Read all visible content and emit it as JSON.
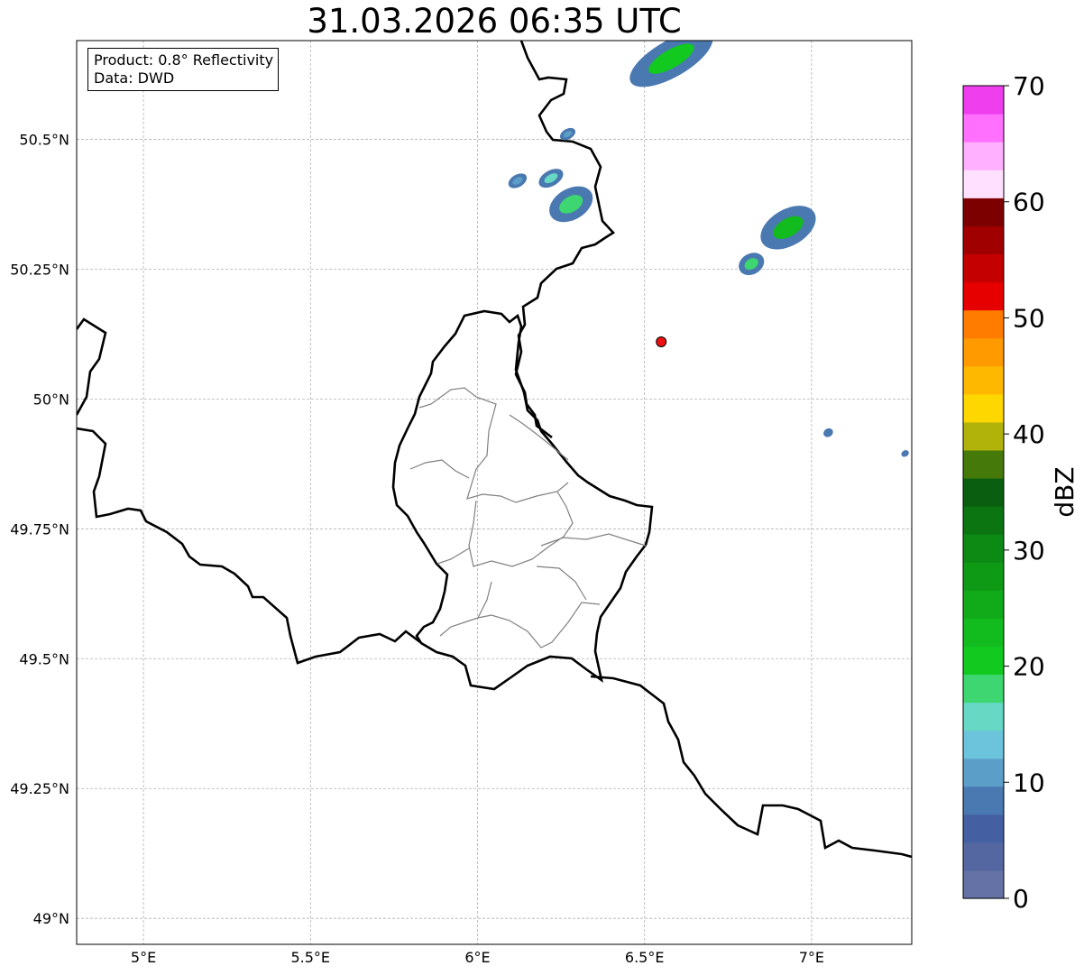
{
  "title": "31.03.2026 06:35 UTC",
  "info": {
    "product": "Product: 0.8° Reflectivity",
    "data_source": "Data: DWD"
  },
  "map": {
    "lon_range": [
      4.8,
      7.3
    ],
    "lat_range": [
      48.95,
      50.69
    ],
    "x_ticks": [
      {
        "value": 5.0,
        "label": "5°E"
      },
      {
        "value": 5.5,
        "label": "5.5°E"
      },
      {
        "value": 6.0,
        "label": "6°E"
      },
      {
        "value": 6.5,
        "label": "6.5°E"
      },
      {
        "value": 7.0,
        "label": "7°E"
      }
    ],
    "y_ticks": [
      {
        "value": 49.0,
        "label": "49°N"
      },
      {
        "value": 49.25,
        "label": "49.25°N"
      },
      {
        "value": 49.5,
        "label": "49.5°N"
      },
      {
        "value": 49.75,
        "label": "49.75°N"
      },
      {
        "value": 50.0,
        "label": "50°N"
      },
      {
        "value": 50.25,
        "label": "50.25°N"
      },
      {
        "value": 50.5,
        "label": "50.5°N"
      }
    ],
    "grid": true,
    "radar_site": {
      "lon": 6.55,
      "lat": 50.11,
      "color": "#ee1111"
    }
  },
  "colorbar": {
    "label": "dBZ",
    "range": [
      0,
      70
    ],
    "ticks": [
      {
        "value": 0,
        "label": "0"
      },
      {
        "value": 10,
        "label": "10"
      },
      {
        "value": 20,
        "label": "20"
      },
      {
        "value": 30,
        "label": "30"
      },
      {
        "value": 40,
        "label": "40"
      },
      {
        "value": 50,
        "label": "50"
      },
      {
        "value": 60,
        "label": "60"
      },
      {
        "value": 70,
        "label": "70"
      }
    ],
    "colors": [
      "#6472a6",
      "#5567a0",
      "#4460a3",
      "#4a78b0",
      "#5b9fc8",
      "#6bc4dc",
      "#66d8c4",
      "#3dd670",
      "#12c91f",
      "#12bb1e",
      "#11aa18",
      "#0f9a16",
      "#0d8a14",
      "#0b7512",
      "#0a5e0f",
      "#457a0a",
      "#b2b30a",
      "#ffd700",
      "#ffb800",
      "#ff9a00",
      "#ff7c00",
      "#e60000",
      "#c40000",
      "#a00000",
      "#7c0000",
      "#ffe0ff",
      "#ffb0ff",
      "#ff70ff",
      "#ee3eee"
    ]
  },
  "echoes": [
    {
      "lon": 6.58,
      "lat": 50.655,
      "rx": 0.14,
      "ry": 0.035,
      "color": "#4a78b0",
      "core": "#12c91f"
    },
    {
      "lon": 6.28,
      "lat": 50.375,
      "rx": 0.07,
      "ry": 0.03,
      "color": "#4a78b0",
      "core": "#3dd670"
    },
    {
      "lon": 6.22,
      "lat": 50.425,
      "rx": 0.04,
      "ry": 0.015,
      "color": "#4a78b0",
      "core": "#66d8c4"
    },
    {
      "lon": 6.12,
      "lat": 50.42,
      "rx": 0.03,
      "ry": 0.012,
      "color": "#4a78b0",
      "core": "#5b9fc8"
    },
    {
      "lon": 6.27,
      "lat": 50.51,
      "rx": 0.025,
      "ry": 0.01,
      "color": "#4a78b0",
      "core": "#5b9fc8"
    },
    {
      "lon": 6.93,
      "lat": 50.33,
      "rx": 0.09,
      "ry": 0.035,
      "color": "#4a78b0",
      "core": "#12bb1e"
    },
    {
      "lon": 6.82,
      "lat": 50.26,
      "rx": 0.04,
      "ry": 0.02,
      "color": "#4a78b0",
      "core": "#3dd670"
    },
    {
      "lon": 7.05,
      "lat": 49.935,
      "rx": 0.015,
      "ry": 0.008,
      "color": "#4a78b0",
      "core": "#4a78b0"
    },
    {
      "lon": 7.28,
      "lat": 49.895,
      "rx": 0.012,
      "ry": 0.006,
      "color": "#4a78b0",
      "core": "#4a78b0"
    }
  ]
}
